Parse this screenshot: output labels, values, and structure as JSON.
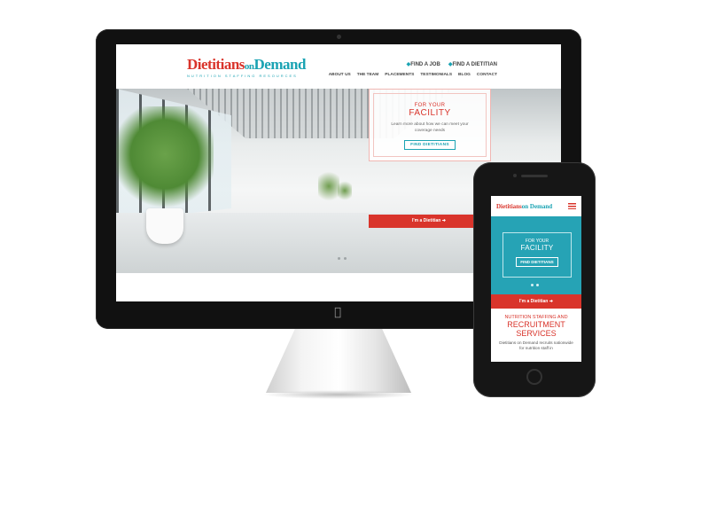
{
  "colors": {
    "brand_red": "#d9342b",
    "brand_teal": "#1aa3b3"
  },
  "desktop": {
    "logo": {
      "word1": "Dietitians",
      "word2": "on",
      "word3": "Demand",
      "tagline": "NUTRITION STAFFING RESOURCES"
    },
    "top_links": [
      "FIND A JOB",
      "FIND A DIETITIAN"
    ],
    "nav": [
      "ABOUT US",
      "THE TEAM",
      "PLACEMENTS",
      "TESTIMONIALS",
      "BLOG",
      "CONTACT"
    ],
    "hero_card": {
      "line1": "FOR YOUR",
      "line2": "FACILITY",
      "text": "Learn more about how we can meet your coverage needs",
      "button": "FIND DIETITIANS"
    },
    "dietitian_button": "I'm a Dietitian ➔"
  },
  "mobile": {
    "logo": {
      "word1": "Dietitians",
      "word2": "on Demand"
    },
    "hero_card": {
      "line1": "FOR YOUR",
      "line2": "FACILITY",
      "button": "FIND DIETITIANS"
    },
    "dietitian_button": "I'm a Dietitian ➔",
    "section": {
      "line1": "NUTRITION STAFFING AND",
      "line2": "RECRUITMENT",
      "line3": "SERVICES",
      "text": "Dietitians on Demand recruits nationwide for nutrition staff in"
    }
  },
  "icons": {
    "apple_logo": "apple-icon",
    "menu": "hamburger-menu-icon"
  }
}
